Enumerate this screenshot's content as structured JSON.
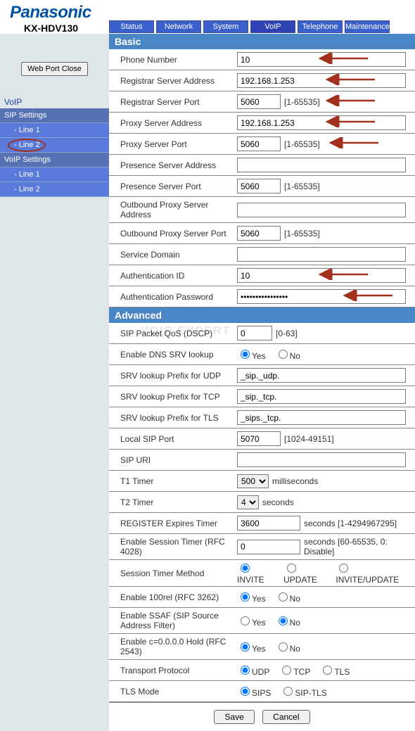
{
  "brand": "Panasonic",
  "model": "KX-HDV130",
  "topnav": {
    "status": "Status",
    "network": "Network",
    "system": "System",
    "voip": "VoIP",
    "telephone": "Telephone",
    "maintenance": "Maintenance"
  },
  "sidebar": {
    "webport": "Web Port Close",
    "title": "VoIP",
    "sip": "SIP Settings",
    "sip_l1": "- Line 1",
    "sip_l2": "- Line 2",
    "voip": "VoIP Settings",
    "voip_l1": "- Line 1",
    "voip_l2": "- Line 2"
  },
  "section_basic": "Basic",
  "section_advanced": "Advanced",
  "basic": {
    "phone_number": {
      "label": "Phone Number",
      "value": "10"
    },
    "registrar_addr": {
      "label": "Registrar Server Address",
      "value": "192.168.1.253"
    },
    "registrar_port": {
      "label": "Registrar Server Port",
      "value": "5060",
      "hint": "[1-65535]"
    },
    "proxy_addr": {
      "label": "Proxy Server Address",
      "value": "192.168.1.253"
    },
    "proxy_port": {
      "label": "Proxy Server Port",
      "value": "5060",
      "hint": "[1-65535]"
    },
    "presence_addr": {
      "label": "Presence Server Address",
      "value": ""
    },
    "presence_port": {
      "label": "Presence Server Port",
      "value": "5060",
      "hint": "[1-65535]"
    },
    "outbound_addr": {
      "label": "Outbound Proxy Server Address",
      "value": ""
    },
    "outbound_port": {
      "label": "Outbound Proxy Server Port",
      "value": "5060",
      "hint": "[1-65535]"
    },
    "service_domain": {
      "label": "Service Domain",
      "value": ""
    },
    "auth_id": {
      "label": "Authentication ID",
      "value": "10"
    },
    "auth_pw": {
      "label": "Authentication Password",
      "value": "••••••••••••••••"
    }
  },
  "advanced": {
    "sip_qos": {
      "label": "SIP Packet QoS (DSCP)",
      "value": "0",
      "hint": "[0-63]"
    },
    "dns_srv": {
      "label": "Enable DNS SRV lookup",
      "yes": "Yes",
      "no": "No"
    },
    "srv_udp": {
      "label": "SRV lookup Prefix for UDP",
      "value": "_sip._udp."
    },
    "srv_tcp": {
      "label": "SRV lookup Prefix for TCP",
      "value": "_sip._tcp."
    },
    "srv_tls": {
      "label": "SRV lookup Prefix for TLS",
      "value": "_sips._tcp."
    },
    "local_sip": {
      "label": "Local SIP Port",
      "value": "5070",
      "hint": "[1024-49151]"
    },
    "sip_uri": {
      "label": "SIP URI",
      "value": ""
    },
    "t1": {
      "label": "T1 Timer",
      "value": "500",
      "unit": "milliseconds"
    },
    "t2": {
      "label": "T2 Timer",
      "value": "4",
      "unit": "seconds"
    },
    "reg_exp": {
      "label": "REGISTER Expires Timer",
      "value": "3600",
      "hint": "seconds [1-4294967295]"
    },
    "sess_timer": {
      "label": "Enable Session Timer (RFC 4028)",
      "value": "0",
      "hint": "seconds [60-65535, 0: Disable]"
    },
    "sess_method": {
      "label": "Session Timer Method",
      "o1": "INVITE",
      "o2": "UPDATE",
      "o3": "INVITE/UPDATE"
    },
    "rel100": {
      "label": "Enable 100rel (RFC 3262)",
      "yes": "Yes",
      "no": "No"
    },
    "ssaf": {
      "label": "Enable SSAF (SIP Source Address Filter)",
      "yes": "Yes",
      "no": "No"
    },
    "c0hold": {
      "label": "Enable c=0.0.0.0 Hold (RFC 2543)",
      "yes": "Yes",
      "no": "No"
    },
    "transport": {
      "label": "Transport Protocol",
      "o1": "UDP",
      "o2": "TCP",
      "o3": "TLS"
    },
    "tlsmode": {
      "label": "TLS Mode",
      "o1": "SIPS",
      "o2": "SIP-TLS"
    }
  },
  "buttons": {
    "save": "Save",
    "cancel": "Cancel"
  },
  "watermark": "VOIP EXPERT"
}
